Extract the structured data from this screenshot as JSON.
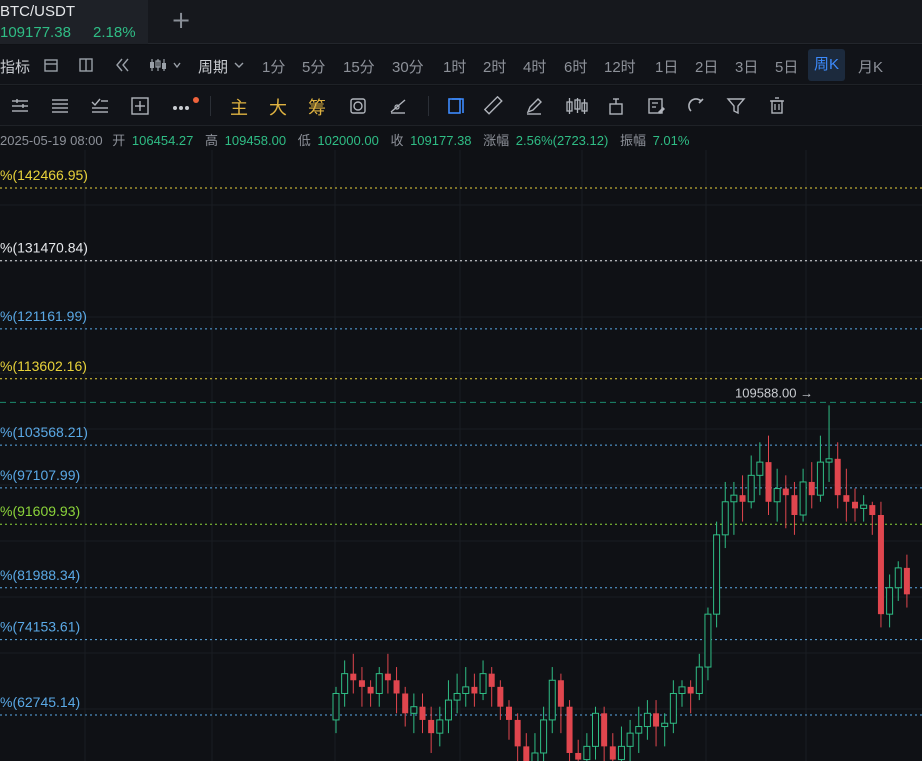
{
  "tab": {
    "symbol": "BTC/USDT",
    "price": "109177.38",
    "change": "2.18%",
    "add_icon": "plus-icon"
  },
  "toolbar": {
    "indicators_label": "指标",
    "period_label": "周期",
    "periods": [
      "1分",
      "5分",
      "15分",
      "30分",
      "1时",
      "2时",
      "4时",
      "6时",
      "12时",
      "1日",
      "2日",
      "3日",
      "5日",
      "周K",
      "月K"
    ],
    "active_period": "周K"
  },
  "drawing_toolbar": {
    "main_label": "主",
    "big_label": "大",
    "chips_label": "筹"
  },
  "info": {
    "date": "2025-05-19 08:00",
    "open_label": "开",
    "open": "106454.27",
    "high_label": "高",
    "high": "109458.00",
    "low_label": "低",
    "low": "102000.00",
    "close_label": "收",
    "close": "109177.38",
    "change_label": "涨幅",
    "change": "2.56%(2723.12)",
    "amplitude_label": "振幅",
    "amplitude": "7.01%"
  },
  "chart_data": {
    "type": "candlestick",
    "marker_label": "109588.00 →",
    "marker_value": 109588.0,
    "fib_levels": [
      {
        "label": "%(142466.95)",
        "value": 142466.95,
        "color": "#e8d33a",
        "dash": "dot"
      },
      {
        "label": "%(131470.84)",
        "value": 131470.84,
        "color": "#e6e8eb",
        "dash": "dot"
      },
      {
        "label": "%(121161.99)",
        "value": 121161.99,
        "color": "#5aa9e6",
        "dash": "dot"
      },
      {
        "label": "%(113602.16)",
        "value": 113602.16,
        "color": "#e8d33a",
        "dash": "dot"
      },
      {
        "label": "%(103568.21)",
        "value": 103568.21,
        "color": "#5aa9e6",
        "dash": "dot"
      },
      {
        "label": "%(97107.99)",
        "value": 97107.99,
        "color": "#5aa9e6",
        "dash": "dot"
      },
      {
        "label": "%(91609.93)",
        "value": 91609.93,
        "color": "#8bd43a",
        "dash": "dot"
      },
      {
        "label": "%(81988.34)",
        "value": 81988.34,
        "color": "#5aa9e6",
        "dash": "dot"
      },
      {
        "label": "%(74153.61)",
        "value": 74153.61,
        "color": "#5aa9e6",
        "dash": "dot"
      },
      {
        "label": "%(62745.14)",
        "value": 62745.14,
        "color": "#5aa9e6",
        "dash": "dot"
      }
    ],
    "candles": [
      [
        62000,
        66000,
        60000,
        67000
      ],
      [
        66000,
        69000,
        64000,
        71000
      ],
      [
        69000,
        68000,
        66000,
        72000
      ],
      [
        68000,
        67000,
        64000,
        70000
      ],
      [
        67000,
        66000,
        64000,
        68000
      ],
      [
        66000,
        69000,
        64000,
        70000
      ],
      [
        69000,
        68000,
        66000,
        72000
      ],
      [
        68000,
        66000,
        63000,
        70000
      ],
      [
        66000,
        63000,
        61000,
        67000
      ],
      [
        63000,
        64000,
        60000,
        66000
      ],
      [
        64000,
        62000,
        60000,
        66000
      ],
      [
        62000,
        60000,
        57000,
        64000
      ],
      [
        60000,
        62000,
        58000,
        64000
      ],
      [
        62000,
        65000,
        60000,
        68000
      ],
      [
        65000,
        66000,
        63000,
        69000
      ],
      [
        66000,
        67000,
        64000,
        70000
      ],
      [
        67000,
        66000,
        64000,
        69000
      ],
      [
        66000,
        69000,
        65000,
        71000
      ],
      [
        69000,
        67000,
        64000,
        70000
      ],
      [
        67000,
        64000,
        62000,
        68000
      ],
      [
        64000,
        62000,
        59000,
        65000
      ],
      [
        62000,
        58000,
        55000,
        63000
      ],
      [
        58000,
        55000,
        52000,
        60000
      ],
      [
        55000,
        57000,
        53000,
        60000
      ],
      [
        57000,
        62000,
        55000,
        64000
      ],
      [
        62000,
        68000,
        60000,
        70000
      ],
      [
        68000,
        64000,
        60000,
        69000
      ],
      [
        64000,
        57000,
        54000,
        65000
      ],
      [
        57000,
        56000,
        53000,
        59000
      ],
      [
        56000,
        58000,
        54000,
        60000
      ],
      [
        58000,
        63000,
        56000,
        64000
      ],
      [
        63000,
        58000,
        54000,
        64000
      ],
      [
        58000,
        56000,
        52000,
        60000
      ],
      [
        56000,
        58000,
        53000,
        61000
      ],
      [
        58000,
        60000,
        55000,
        62000
      ],
      [
        60000,
        61000,
        57000,
        64000
      ],
      [
        61000,
        63000,
        59000,
        65000
      ],
      [
        63000,
        61000,
        58000,
        65000
      ],
      [
        61000,
        61500,
        58000,
        63000
      ],
      [
        61500,
        66000,
        60000,
        68000
      ],
      [
        66000,
        67000,
        64000,
        68000
      ],
      [
        67000,
        66000,
        63000,
        68000
      ],
      [
        66000,
        70000,
        65000,
        72000
      ],
      [
        70000,
        78000,
        68000,
        79000
      ],
      [
        78000,
        90000,
        76000,
        92000
      ],
      [
        90000,
        95000,
        88000,
        98000
      ],
      [
        95000,
        96000,
        90000,
        98000
      ],
      [
        96000,
        95000,
        92000,
        99000
      ],
      [
        95000,
        99000,
        94000,
        102000
      ],
      [
        99000,
        101000,
        96000,
        104000
      ],
      [
        101000,
        95000,
        93000,
        105000
      ],
      [
        95000,
        97000,
        92000,
        100000
      ],
      [
        97000,
        96000,
        91000,
        99000
      ],
      [
        96000,
        93000,
        90000,
        98000
      ],
      [
        93000,
        98000,
        92000,
        100000
      ],
      [
        98000,
        96000,
        94000,
        101000
      ],
      [
        96000,
        101000,
        95000,
        105000
      ],
      [
        101000,
        101500,
        98000,
        109588
      ],
      [
        101500,
        96000,
        94000,
        104000
      ],
      [
        96000,
        95000,
        92000,
        100000
      ],
      [
        95000,
        94000,
        92000,
        97000
      ],
      [
        94000,
        94500,
        92000,
        96000
      ],
      [
        94500,
        93000,
        90000,
        95000
      ],
      [
        93000,
        78000,
        76000,
        95000
      ],
      [
        78000,
        82000,
        76000,
        84000
      ],
      [
        82000,
        85000,
        80000,
        86000
      ],
      [
        85000,
        81000,
        79000,
        87000
      ]
    ]
  }
}
